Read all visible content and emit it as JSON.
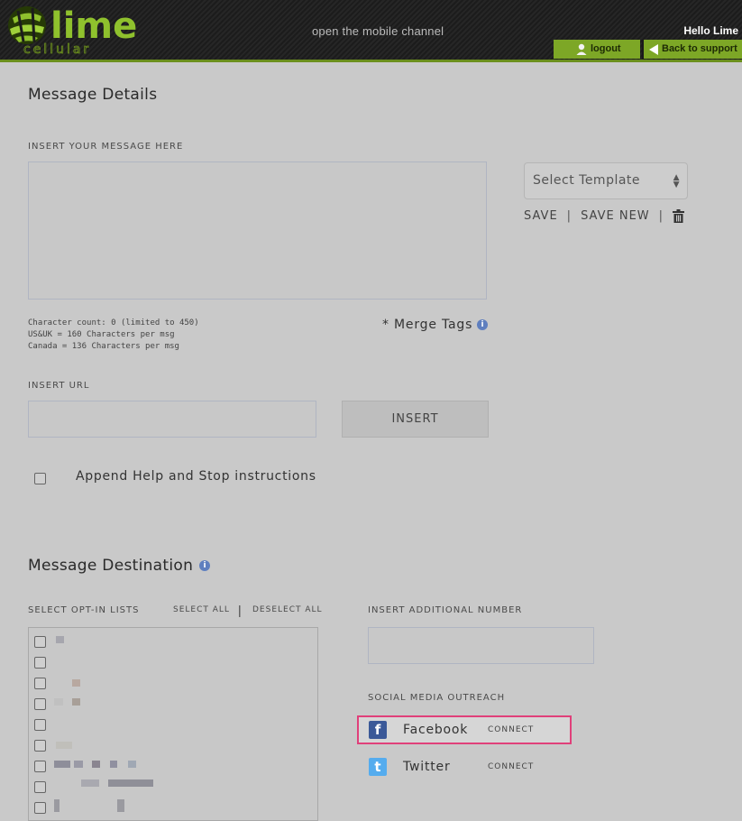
{
  "header": {
    "brand_name": "lime",
    "brand_sub": "cellular",
    "tagline": "open the mobile channel",
    "greeting": "Hello Lime",
    "logout_label": "logout",
    "support_label": "Back to support",
    "accent_color": "#7da726"
  },
  "message_details": {
    "title": "Message Details",
    "message_label": "INSERT YOUR MESSAGE HERE",
    "message_value": "",
    "char_count": "Character count: 0 (limited to 450)",
    "usuk_info": "US&UK = 160 Characters per msg",
    "canada_info": "Canada = 136 Characters per msg",
    "merge_tags": "* Merge Tags",
    "template": {
      "selected": "Select Template",
      "save": "SAVE",
      "save_new": "SAVE NEW"
    },
    "url_label": "INSERT URL",
    "url_value": "",
    "insert_button": "INSERT",
    "append_label": "Append Help and Stop instructions"
  },
  "destination": {
    "title": "Message Destination",
    "optin_label": "SELECT OPT-IN LISTS",
    "select_all": "SELECT ALL",
    "deselect_all": "DESELECT ALL",
    "additional_label": "INSERT ADDITIONAL NUMBER",
    "additional_value": "",
    "social_label": "SOCIAL MEDIA OUTREACH",
    "social": [
      {
        "name": "Facebook",
        "action": "CONNECT",
        "icon": "facebook-icon",
        "color": "#3b5998"
      },
      {
        "name": "Twitter",
        "action": "CONNECT",
        "icon": "twitter-icon",
        "color": "#55acee"
      }
    ]
  }
}
